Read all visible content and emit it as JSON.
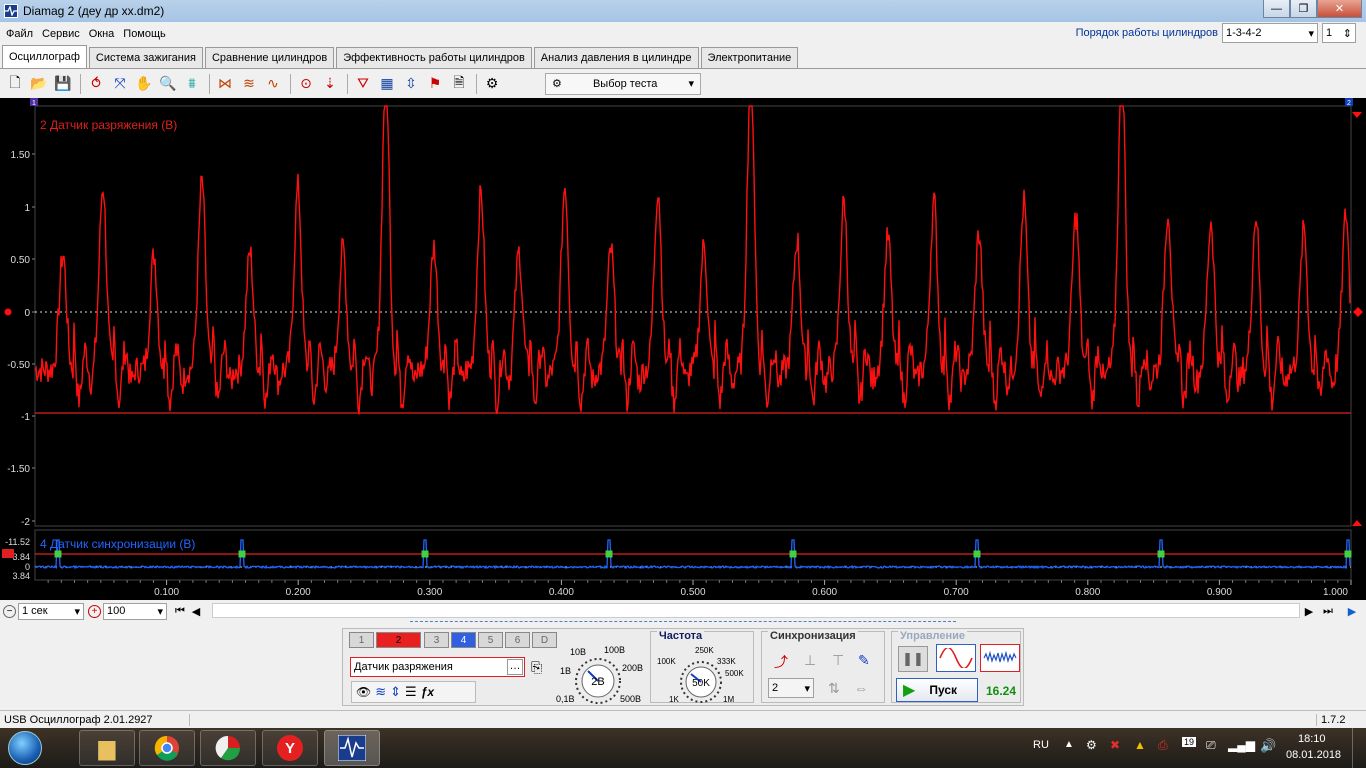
{
  "window": {
    "title": "Diamag 2 (деу др хх.dm2)",
    "minimize": "—",
    "maximize": "❐",
    "close": "✕"
  },
  "menu": {
    "items": [
      "Файл",
      "Сервис",
      "Окна",
      "Помощь"
    ]
  },
  "firing_order": {
    "label": "Порядок работы цилиндров",
    "value": "1-3-4-2",
    "count": "1"
  },
  "tabs": [
    "Осциллограф",
    "Система зажигания",
    "Сравнение цилиндров",
    "Эффективность работы цилиндров",
    "Анализ давления в цилиндре",
    "Электропитание"
  ],
  "toolbar": {
    "test_select": "Выбор теста"
  },
  "scope": {
    "ch2_label": "2 Датчик разряжения (В)",
    "ch4_label": "4 Датчик синхронизации (В)",
    "y_ticks": [
      "1.50",
      "1",
      "0.50",
      "0",
      "-0.50",
      "-1",
      "-1.50",
      "-2"
    ],
    "y_ticks_sync": [
      "-11.52",
      "3.84",
      "0",
      "3.84"
    ],
    "x_ticks": [
      "0.100",
      "0.200",
      "0.300",
      "0.400",
      "0.500",
      "0.600",
      "0.700",
      "0.800",
      "0.900",
      "1.000"
    ],
    "marker_left": "1",
    "marker_right": "2"
  },
  "bottom": {
    "timebase": "1 сек",
    "zoom": "100"
  },
  "controls": {
    "channels": [
      "1",
      "2",
      "3",
      "4",
      "5",
      "6",
      "D"
    ],
    "channel_name": "Датчик разряжения",
    "voltage": {
      "value": "2В",
      "labels": [
        "10В",
        "100В",
        "1В",
        "200В",
        "0,1В",
        "500В"
      ]
    },
    "freq": {
      "title": "Частота",
      "value": "50K",
      "labels": [
        "250K",
        "100K",
        "333K",
        "500K",
        "1K",
        "1M"
      ]
    },
    "sync": {
      "title": "Синхронизация",
      "channel": "2"
    },
    "control": {
      "title": "Управление",
      "start": "Пуск",
      "fps": "16.24"
    }
  },
  "status": {
    "left": "USB Осциллограф  2.01.2927",
    "right": "1.7.2"
  },
  "taskbar": {
    "lang": "RU",
    "time": "18:10",
    "date": "08.01.2018",
    "badge": "19"
  },
  "colors": {
    "ch2": "#ff1010",
    "ch4": "#2266ff",
    "accent": "#e02020"
  }
}
